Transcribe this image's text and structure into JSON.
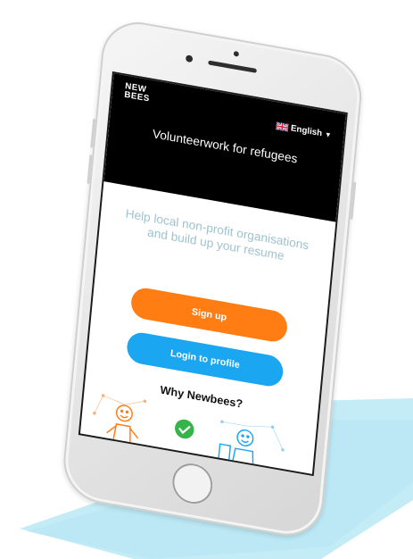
{
  "app": {
    "logo": {
      "line1": "NEW",
      "line2": "BEES"
    },
    "language": {
      "label": "English",
      "flag_icon": "uk-flag-icon",
      "caret_icon": "caret-down-icon"
    },
    "tagline": "Volunteerwork for refugees",
    "intro": "Help local non-profit organisations and build up your resume",
    "buttons": {
      "signup": "Sign up",
      "login": "Login to profile"
    },
    "section_title": "Why Newbees?",
    "illustration": [
      "orange-person-icon",
      "green-check-icon",
      "blue-person-icon"
    ]
  },
  "colors": {
    "header_bg": "#000000",
    "signup": "#ff7d12",
    "login": "#1aa6f0",
    "check": "#35b44a",
    "intro_text": "#9fc2cf",
    "shadow": "#bfe9f4"
  }
}
